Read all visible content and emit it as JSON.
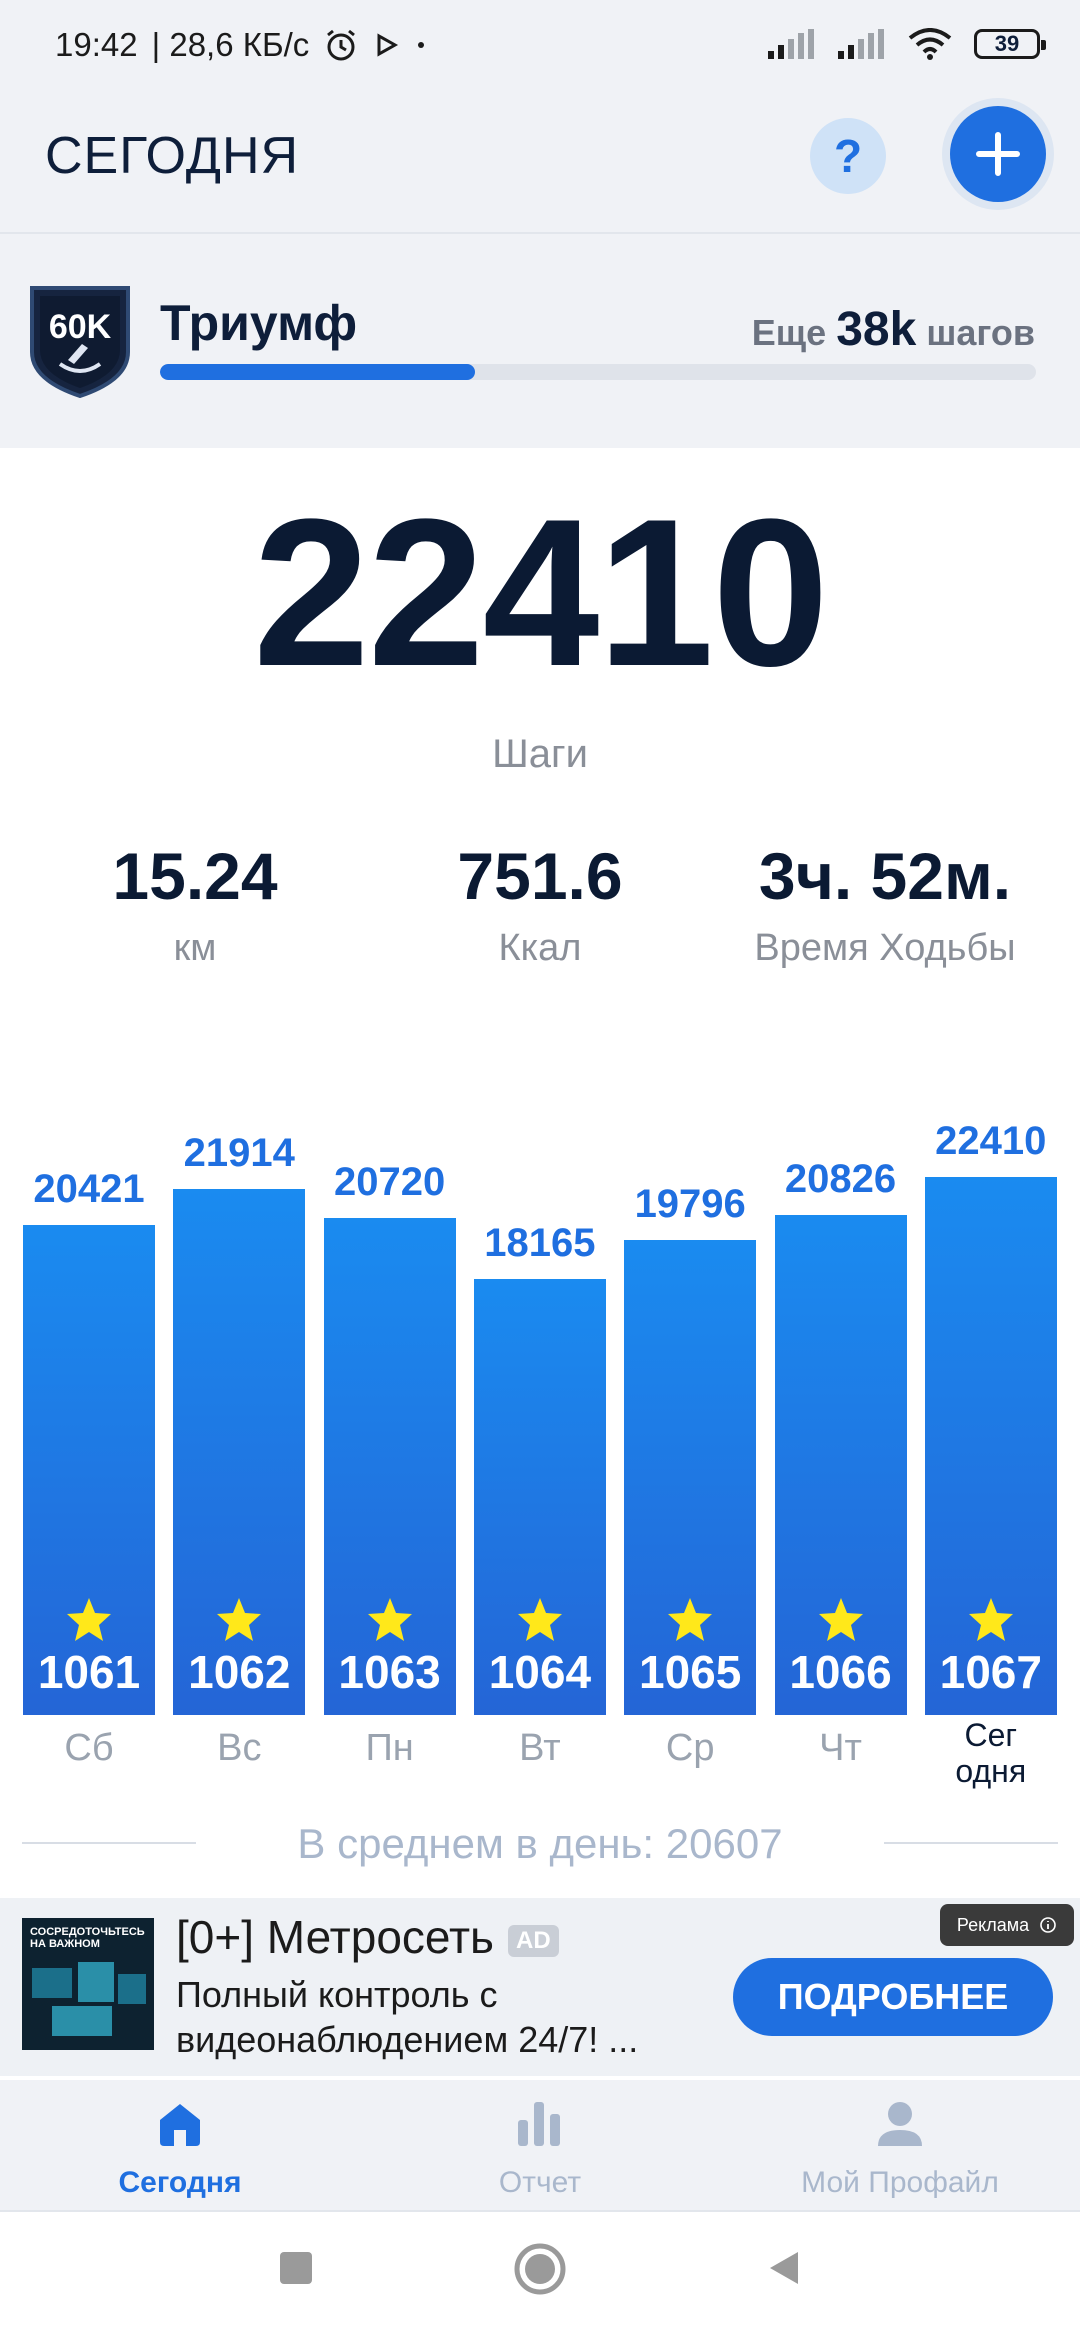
{
  "status_bar": {
    "time": "19:42",
    "speed": "| 28,6 КБ/с",
    "battery": "39",
    "icons": [
      "alarm-icon",
      "play-icon",
      "dot-icon",
      "signal-icon",
      "signal-icon",
      "wifi-icon",
      "battery-icon"
    ]
  },
  "header": {
    "title": "СЕГОДНЯ",
    "help_label": "?"
  },
  "achievement": {
    "badge_text": "60K",
    "name": "Триумф",
    "remaining_prefix": "Еще",
    "remaining_value": "38k",
    "remaining_suffix": "шагов",
    "progress": 0.36
  },
  "summary": {
    "steps": "22410",
    "steps_label": "Шаги",
    "distance": "15.24",
    "distance_unit": "км",
    "calories": "751.6",
    "calories_unit": "Ккал",
    "walk_time": "3ч. 52м.",
    "walk_time_label": "Время Ходьбы"
  },
  "chart_data": {
    "type": "bar",
    "categories": [
      "Сб",
      "Вс",
      "Пн",
      "Вт",
      "Ср",
      "Чт",
      "Сег одня"
    ],
    "values": [
      20421,
      21914,
      20720,
      18165,
      19796,
      20826,
      22410
    ],
    "ranks": [
      "1061",
      "1062",
      "1063",
      "1064",
      "1065",
      "1066",
      "1067"
    ],
    "title": "",
    "xlabel": "",
    "ylabel": "",
    "bar_color": "#1a8bf0",
    "grid": false
  },
  "average": {
    "text": "В среднем в день: 20607"
  },
  "ad": {
    "image_text": "СОСРЕДОТОЧЬТЕСЬ НА ВАЖНОМ",
    "title": "[0+] Метросеть",
    "badge": "AD",
    "description": "Полный контроль с видеонаблюдением 24/7! ...",
    "label": "Реклама",
    "cta": "ПОДРОБНЕЕ"
  },
  "bottom_nav": {
    "items": [
      {
        "label": "Сегодня",
        "icon": "home-icon",
        "active": true
      },
      {
        "label": "Отчет",
        "icon": "report-icon",
        "active": false
      },
      {
        "label": "Мой Профайл",
        "icon": "profile-icon",
        "active": false
      }
    ]
  },
  "colors": {
    "accent": "#1f6fe0",
    "nav_inactive": "#a9b7cc",
    "text_dark": "#0b1a33"
  }
}
